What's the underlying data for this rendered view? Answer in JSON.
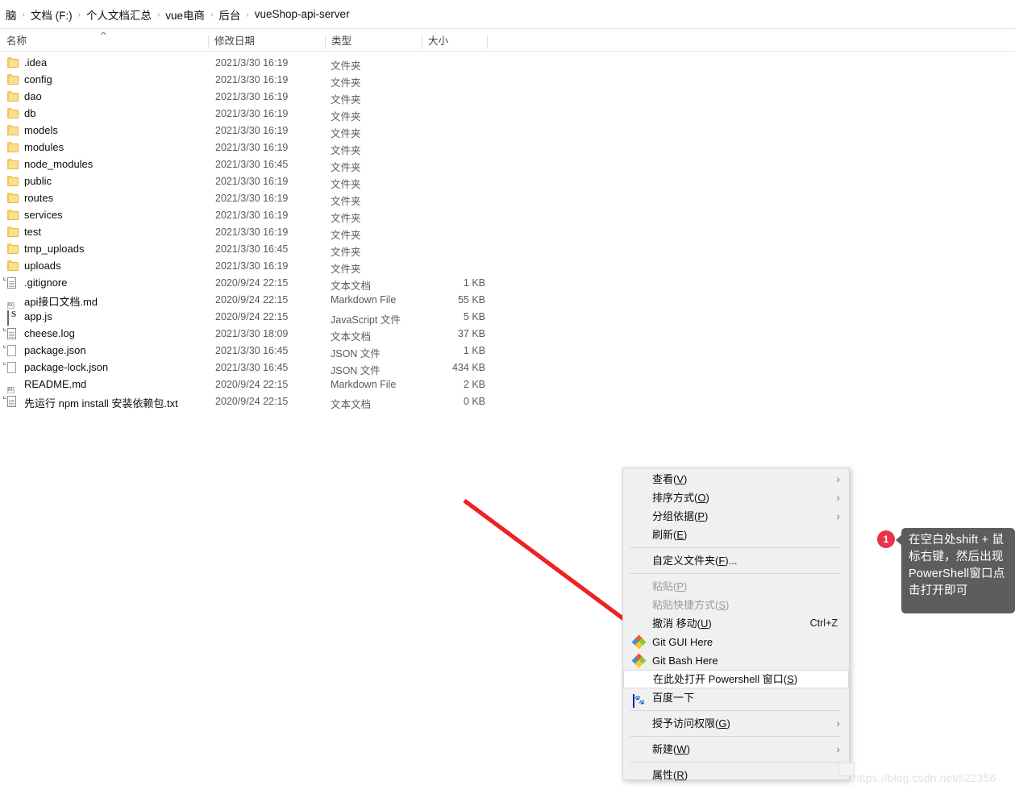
{
  "window": {
    "title": "vueShop-api-server",
    "breadcrumb": [
      "脑",
      "文档 (F:)",
      "个人文档汇总",
      "vue电商",
      "后台",
      "vueShop-api-server"
    ],
    "separator": "›"
  },
  "columns": {
    "name": "名称",
    "date": "修改日期",
    "type": "类型",
    "size": "大小",
    "sort_caret": "︿"
  },
  "files": [
    {
      "icon": "folder",
      "name": ".idea",
      "date": "2021/3/30 16:19",
      "type": "文件夹",
      "size": ""
    },
    {
      "icon": "folder",
      "name": "config",
      "date": "2021/3/30 16:19",
      "type": "文件夹",
      "size": ""
    },
    {
      "icon": "folder",
      "name": "dao",
      "date": "2021/3/30 16:19",
      "type": "文件夹",
      "size": ""
    },
    {
      "icon": "folder",
      "name": "db",
      "date": "2021/3/30 16:19",
      "type": "文件夹",
      "size": ""
    },
    {
      "icon": "folder",
      "name": "models",
      "date": "2021/3/30 16:19",
      "type": "文件夹",
      "size": ""
    },
    {
      "icon": "folder",
      "name": "modules",
      "date": "2021/3/30 16:19",
      "type": "文件夹",
      "size": ""
    },
    {
      "icon": "folder",
      "name": "node_modules",
      "date": "2021/3/30 16:45",
      "type": "文件夹",
      "size": ""
    },
    {
      "icon": "folder",
      "name": "public",
      "date": "2021/3/30 16:19",
      "type": "文件夹",
      "size": ""
    },
    {
      "icon": "folder",
      "name": "routes",
      "date": "2021/3/30 16:19",
      "type": "文件夹",
      "size": ""
    },
    {
      "icon": "folder",
      "name": "services",
      "date": "2021/3/30 16:19",
      "type": "文件夹",
      "size": ""
    },
    {
      "icon": "folder",
      "name": "test",
      "date": "2021/3/30 16:19",
      "type": "文件夹",
      "size": ""
    },
    {
      "icon": "folder",
      "name": "tmp_uploads",
      "date": "2021/3/30 16:45",
      "type": "文件夹",
      "size": ""
    },
    {
      "icon": "folder",
      "name": "uploads",
      "date": "2021/3/30 16:19",
      "type": "文件夹",
      "size": ""
    },
    {
      "icon": "textdoc",
      "name": ".gitignore",
      "date": "2020/9/24 22:15",
      "type": "文本文档",
      "size": "1 KB"
    },
    {
      "icon": "markdown",
      "name": "api接口文档.md",
      "date": "2020/9/24 22:15",
      "type": "Markdown File",
      "size": "55 KB"
    },
    {
      "icon": "js",
      "name": "app.js",
      "date": "2020/9/24 22:15",
      "type": "JavaScript 文件",
      "size": "5 KB"
    },
    {
      "icon": "textdoc",
      "name": "cheese.log",
      "date": "2021/3/30 18:09",
      "type": "文本文档",
      "size": "37 KB"
    },
    {
      "icon": "page",
      "name": "package.json",
      "date": "2021/3/30 16:45",
      "type": "JSON 文件",
      "size": "1 KB"
    },
    {
      "icon": "page",
      "name": "package-lock.json",
      "date": "2021/3/30 16:45",
      "type": "JSON 文件",
      "size": "434 KB"
    },
    {
      "icon": "markdown",
      "name": "README.md",
      "date": "2020/9/24 22:15",
      "type": "Markdown File",
      "size": "2 KB"
    },
    {
      "icon": "textdoc",
      "name": "先运行 npm install 安装依赖包.txt",
      "date": "2020/9/24 22:15",
      "type": "文本文档",
      "size": "0 KB"
    }
  ],
  "context_menu": [
    {
      "kind": "item",
      "label": "查看(V)",
      "mnemonic": "V",
      "submenu": true,
      "disabled": false,
      "accel": "",
      "icon": ""
    },
    {
      "kind": "item",
      "label": "排序方式(O)",
      "mnemonic": "O",
      "submenu": true,
      "disabled": false,
      "accel": "",
      "icon": ""
    },
    {
      "kind": "item",
      "label": "分组依据(P)",
      "mnemonic": "P",
      "submenu": true,
      "disabled": false,
      "accel": "",
      "icon": ""
    },
    {
      "kind": "item",
      "label": "刷新(E)",
      "mnemonic": "E",
      "submenu": false,
      "disabled": false,
      "accel": "",
      "icon": ""
    },
    {
      "kind": "sep"
    },
    {
      "kind": "item",
      "label": "自定义文件夹(F)...",
      "mnemonic": "F",
      "submenu": false,
      "disabled": false,
      "accel": "",
      "icon": ""
    },
    {
      "kind": "sep"
    },
    {
      "kind": "item",
      "label": "粘贴(P)",
      "mnemonic": "P",
      "submenu": false,
      "disabled": true,
      "accel": "",
      "icon": ""
    },
    {
      "kind": "item",
      "label": "粘贴快捷方式(S)",
      "mnemonic": "S",
      "submenu": false,
      "disabled": true,
      "accel": "",
      "icon": ""
    },
    {
      "kind": "item",
      "label": "撤消 移动(U)",
      "mnemonic": "U",
      "submenu": false,
      "disabled": false,
      "accel": "Ctrl+Z",
      "icon": ""
    },
    {
      "kind": "item",
      "label": "Git GUI Here",
      "mnemonic": "",
      "submenu": false,
      "disabled": false,
      "accel": "",
      "icon": "git"
    },
    {
      "kind": "item",
      "label": "Git Bash Here",
      "mnemonic": "",
      "submenu": false,
      "disabled": false,
      "accel": "",
      "icon": "git"
    },
    {
      "kind": "item",
      "label": "在此处打开 Powershell 窗口(S)",
      "mnemonic": "S",
      "submenu": false,
      "disabled": false,
      "accel": "",
      "icon": "",
      "highlighted": true
    },
    {
      "kind": "item",
      "label": "百度一下",
      "mnemonic": "",
      "submenu": false,
      "disabled": false,
      "accel": "",
      "icon": "baidu"
    },
    {
      "kind": "sep"
    },
    {
      "kind": "item",
      "label": "授予访问权限(G)",
      "mnemonic": "G",
      "submenu": true,
      "disabled": false,
      "accel": "",
      "icon": ""
    },
    {
      "kind": "sep"
    },
    {
      "kind": "item",
      "label": "新建(W)",
      "mnemonic": "W",
      "submenu": true,
      "disabled": false,
      "accel": "",
      "icon": ""
    },
    {
      "kind": "sep"
    },
    {
      "kind": "item",
      "label": "属性(R)",
      "mnemonic": "R",
      "submenu": false,
      "disabled": false,
      "accel": "",
      "icon": ""
    }
  ],
  "annotation": {
    "badge": "1",
    "text": "在空白处shift + 鼠标右键，然后出现PowerShell窗口点击打开即可",
    "arrow_color": "#ee2222"
  },
  "watermark": "https://blog.csdn.net/li22356",
  "colors": {
    "menu_bg": "#f0f0f0",
    "highlight": "#ffffff",
    "badge": "#e8334a",
    "callout_bg": "#5d5d5d",
    "chevron": "#b8792e",
    "folder": "#fbdf8b"
  }
}
